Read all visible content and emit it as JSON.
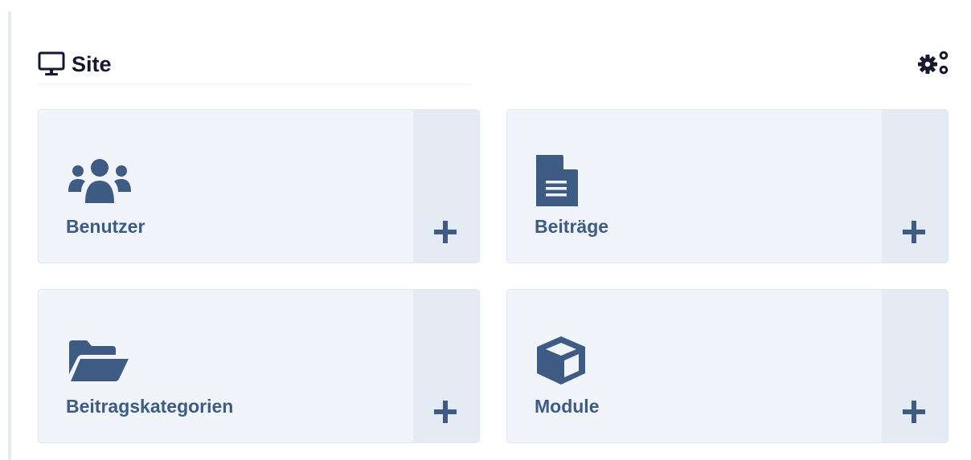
{
  "header": {
    "title": "Site",
    "title_icon": "desktop-icon",
    "settings_icon": "cogs-icon"
  },
  "colors": {
    "accent": "#3e5b83",
    "tile_bg": "#f1f5fb",
    "add_bg": "#e4ebf4",
    "title_text": "#15182e"
  },
  "tiles": [
    {
      "label": "Benutzer",
      "icon": "users-icon",
      "add_icon": "plus-icon"
    },
    {
      "label": "Beiträge",
      "icon": "file-text-icon",
      "add_icon": "plus-icon"
    },
    {
      "label": "Beitragskategorien",
      "icon": "folder-open-icon",
      "add_icon": "plus-icon"
    },
    {
      "label": "Module",
      "icon": "cube-icon",
      "add_icon": "plus-icon"
    }
  ]
}
